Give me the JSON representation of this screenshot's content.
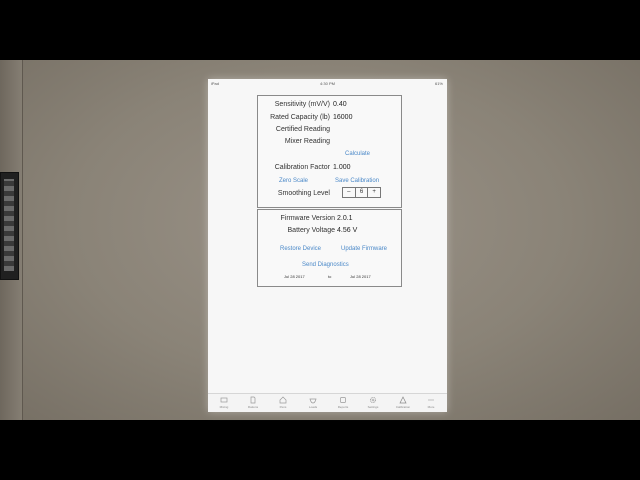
{
  "status": {
    "device": "iPad",
    "time": "4:30 PM",
    "battery": "61%"
  },
  "calibration": {
    "sensitivity_label": "Sensitivity (mV/V)",
    "sensitivity_value": "0.40",
    "capacity_label": "Rated Capacity (lb)",
    "capacity_value": "16000",
    "certified_label": "Certified Reading",
    "mixer_label": "Mixer Reading",
    "calculate_label": "Calculate",
    "factor_label": "Calibration Factor",
    "factor_value": "1.000",
    "zero_scale_label": "Zero Scale",
    "save_calibration_label": "Save Calibration",
    "smoothing_label": "Smoothing Level",
    "smoothing_minus": "–",
    "smoothing_value": "6",
    "smoothing_plus": "+"
  },
  "device": {
    "firmware_label": "Firmware Version",
    "firmware_value": "2.0.1",
    "battery_label": "Battery Voltage",
    "battery_value": "4.56 V",
    "restore_label": "Restore Device",
    "update_label": "Update Firmware",
    "diagnostics_label": "Send Diagnostics",
    "date_from": "Jul 28 2017",
    "date_to_word": "to",
    "date_to": "Jul 28 2017"
  },
  "tabs": [
    {
      "label": "Mixing",
      "icon": "mixer-icon"
    },
    {
      "label": "Rations",
      "icon": "document-icon"
    },
    {
      "label": "Pens",
      "icon": "barn-icon"
    },
    {
      "label": "Loads",
      "icon": "bowl-icon"
    },
    {
      "label": "Reports",
      "icon": "report-icon"
    },
    {
      "label": "Settings",
      "icon": "gear-icon"
    },
    {
      "label": "Calibration",
      "icon": "scale-icon"
    },
    {
      "label": "More",
      "icon": "more-icon"
    }
  ]
}
